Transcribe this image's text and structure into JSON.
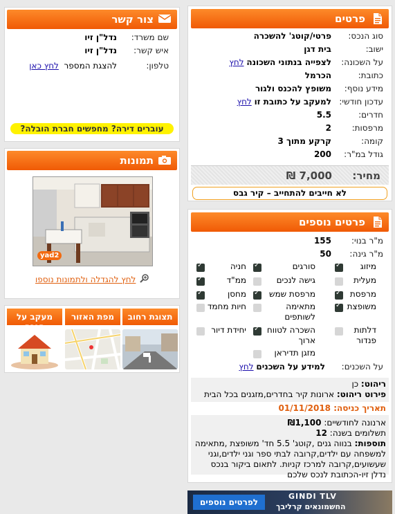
{
  "details": {
    "title": "פרטים",
    "rows": [
      {
        "label": "סוג הנכס:",
        "value": "פרטי/קוטג' להשכרה"
      },
      {
        "label": "ישוב:",
        "value": "בית דגן"
      },
      {
        "label": "על השכונה:",
        "value": "לצפייה בנתוני השכונה",
        "link": "לחץ"
      },
      {
        "label": "כתובת:",
        "value": "הכרמל"
      },
      {
        "label": "מידע נוסף:",
        "value": "משופץ להכנס ולגור"
      },
      {
        "label": "עדכון חודשי:",
        "value": "למעקב על כתובת זו",
        "link": "לחץ"
      },
      {
        "label": "חדרים:",
        "value": "5.5"
      },
      {
        "label": "מרפסות:",
        "value": "2"
      },
      {
        "label": "קומה:",
        "value": "קרקע מתוך 3"
      },
      {
        "label": "גודל במ\"ר:",
        "value": "200"
      }
    ],
    "price_label": "מחיר:",
    "price": "7,000 ₪",
    "notice": "לא חייבים להתחייב – קיר גבס"
  },
  "contact": {
    "title": "צור קשר",
    "name_label": "שם משרד:",
    "name_value": "נדל\"ן זיו",
    "person_label": "איש קשר:",
    "person_value": "נדל\"ן זיו",
    "phone_label": "טלפון:",
    "phone_text": "להצגת המספר",
    "phone_link": "לחץ כאן",
    "moving_banner": "עוברים דירה? מחפשים חברת הובלה?"
  },
  "photos": {
    "title": "תמונות",
    "watermark": "yad2",
    "enlarge_link": "לחץ להגדלה ולתמונות נוספו"
  },
  "tabs": [
    {
      "label": "תצוגת רחוב"
    },
    {
      "label": "מפת האזור"
    },
    {
      "label": "מעקב על הנכס"
    }
  ],
  "more": {
    "title": "פרטים נוספים",
    "built_label": "מ\"ר בנוי:",
    "built_value": "155",
    "garden_label": "מ\"ר גינה:",
    "garden_value": "50",
    "features": [
      {
        "label": "מיזוג",
        "on": true
      },
      {
        "label": "סורגים",
        "on": true
      },
      {
        "label": "חניה",
        "on": true
      },
      {
        "label": "מעלית",
        "on": false
      },
      {
        "label": "גישה לנכים",
        "on": false
      },
      {
        "label": "ממ\"ד",
        "on": true
      },
      {
        "label": "מרפסת",
        "on": true
      },
      {
        "label": "מרפסת שמש",
        "on": true
      },
      {
        "label": "מחסן",
        "on": true
      },
      {
        "label": "משופצת",
        "on": true
      },
      {
        "label": "מתאימה לשותפים",
        "on": false
      },
      {
        "label": "חיות מחמד",
        "on": false
      },
      {
        "label": "דלתות פנדור",
        "on": false
      },
      {
        "label": "השכרה לטווח ארוך",
        "on": true
      },
      {
        "label": "יחידת דיור",
        "on": false
      },
      {
        "label": "מזגן תדיראן",
        "on": false
      }
    ],
    "neighbors_label": "על השכנים:",
    "neighbors_value": "למידע על השכנים",
    "neighbors_link": "לחץ"
  },
  "extra": {
    "furniture_label": "ריהוט:",
    "furniture_value": "כן",
    "furniture_detail_label": "פירוט ריהוט:",
    "furniture_detail": "ארונות קיר בחדרים,מזגנים בכל הבית",
    "entry_label": "תאריך כניסה:",
    "entry_date": "01/11/2018",
    "arnona_label": "ארנונה לחודשיים:",
    "arnona_value": "₪1,100",
    "payments_label": "תשלומים בשנה:",
    "payments_value": "12",
    "additions_label": "תוספות:",
    "additions_text": "בנווה גנים ,קוטג' 5.5 חד' משופצת ,מתאימה למשפחה עם ילדים,קרובה לבתי ספר וגני ילדים,וגני שעשועים,קרובה למרכז קניות. לתאום ביקור בנכס נדלן זיו-הכתובת לנכס שלכם"
  },
  "ad": {
    "button": "לפרטים נוספים <<",
    "brand": "GINDI TLV",
    "tagline": "החשמונאים קרליבך"
  },
  "colors": {
    "accent": "#f26a10",
    "yellow": "#fff200"
  }
}
